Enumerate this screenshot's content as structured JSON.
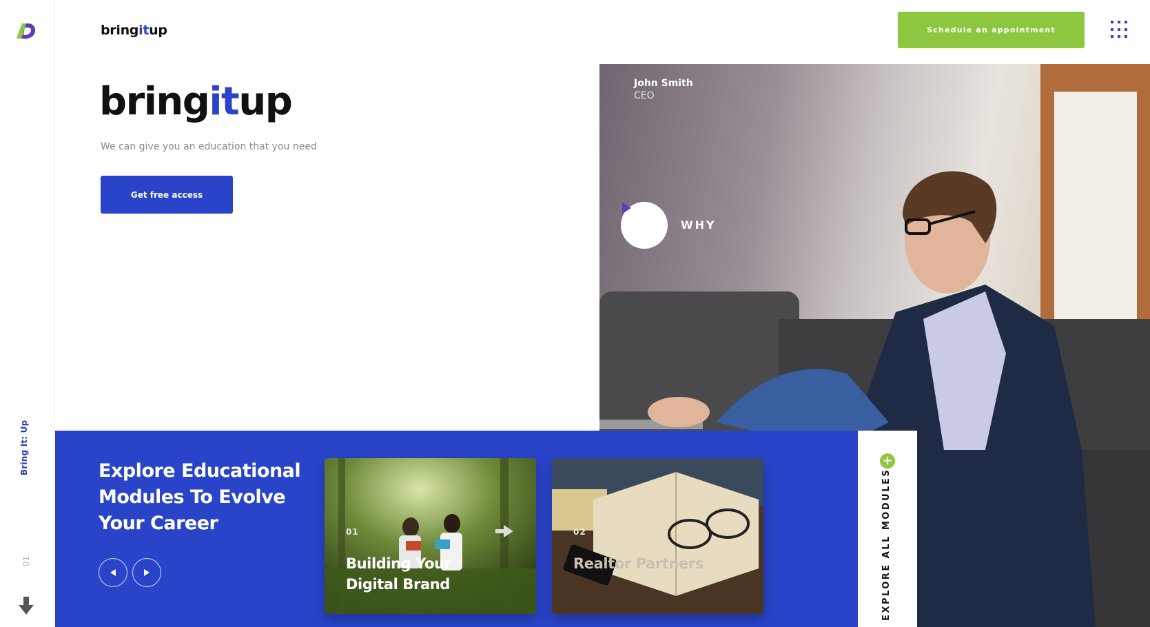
{
  "header": {
    "brand": {
      "part1": "bring",
      "part2": "it",
      "part3": "up"
    },
    "cta_label": "Schedule an appointment",
    "menu_icon": "grid-menu-icon"
  },
  "sidebar": {
    "vertical_title": "Bring It: Up",
    "slide_number": "01",
    "scroll_icon": "arrow-down-icon"
  },
  "hero": {
    "brand": {
      "part1": "bring",
      "part2": "it",
      "part3": "up"
    },
    "tagline": "We can give you an education that you need",
    "button_label": "Get free access"
  },
  "video": {
    "person_name": "John Smith",
    "person_role": "CEO",
    "play_label": "WHY"
  },
  "modules": {
    "title": "Explore Educational Modules To Evolve Your Career",
    "cards": [
      {
        "number": "01",
        "title": "Building Your Digital Brand"
      },
      {
        "number": "02",
        "title": "Realtor Partners"
      }
    ],
    "explore_label": "EXPLORE ALL MODULES"
  },
  "colors": {
    "primary_blue": "#2944c9",
    "accent_green": "#8dc63f",
    "menu_purple": "#4a3bb6"
  }
}
